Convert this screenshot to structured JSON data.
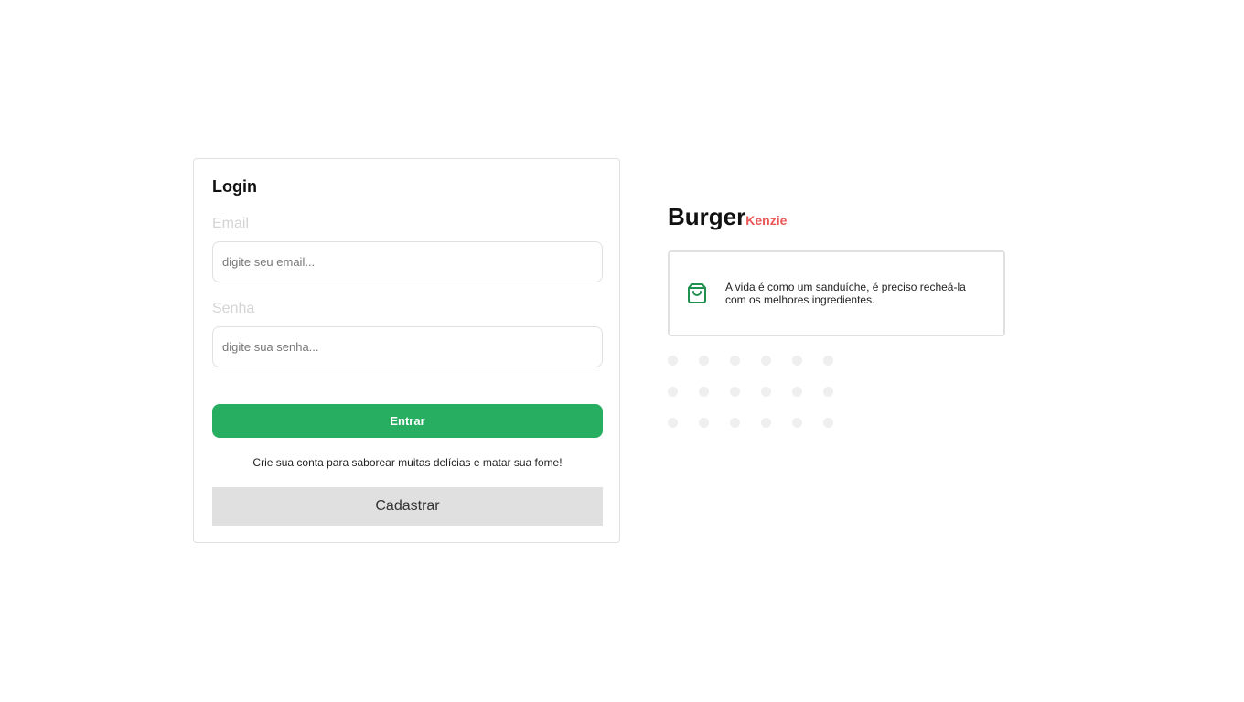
{
  "login": {
    "title": "Login",
    "email_label": "Email",
    "email_placeholder": "digite seu email...",
    "email_value": "",
    "password_label": "Senha",
    "password_placeholder": "digite sua senha...",
    "password_value": "",
    "submit_label": "Entrar",
    "signup_hint": "Crie sua conta para saborear muitas delícias e matar sua fome!",
    "signup_label": "Cadastrar"
  },
  "brand": {
    "name": "Burger",
    "suffix": "Kenzie"
  },
  "info": {
    "icon": "shopping-bag-icon",
    "text": "A vida é como um sanduíche, é preciso recheá-la com os melhores ingredientes."
  },
  "colors": {
    "primary": "#27ae60",
    "secondary": "#eb5757",
    "gray": "#e0e0e0"
  }
}
